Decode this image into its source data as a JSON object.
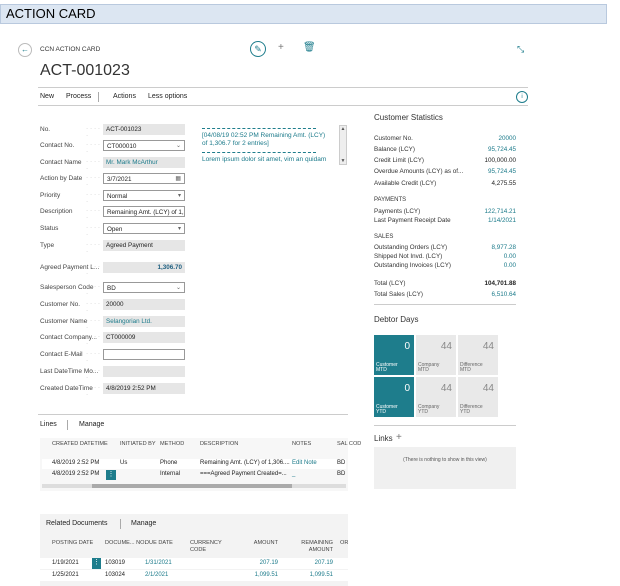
{
  "banner": {
    "title": "ACTION CARD"
  },
  "page": {
    "caption": "CCN ACTION CARD",
    "record_no": "ACT-001023",
    "icons": {
      "back": "back-arrow-icon",
      "edit": "pencil-icon",
      "new": "plus-icon",
      "delete": "trash-icon",
      "collapse": "collapse-icon",
      "info": "info-icon"
    }
  },
  "menu": {
    "new": "New",
    "process": "Process",
    "actions": "Actions",
    "less": "Less options"
  },
  "fields": [
    {
      "label": "No.",
      "value": "ACT-001023"
    },
    {
      "label": "Contact No.",
      "value": "CT000010"
    },
    {
      "label": "Contact Name",
      "value": "Mr. Mark McArthur"
    },
    {
      "label": "Action by Date",
      "value": "3/7/2021"
    },
    {
      "label": "Priority",
      "value": "Normal"
    },
    {
      "label": "Description",
      "value": "Remaining Amt. (LCY) of 1,30"
    },
    {
      "label": "Status",
      "value": "Open"
    },
    {
      "label": "Type",
      "value": "Agreed Payment"
    },
    {
      "label": "Agreed Payment L...",
      "value": "1,306.70"
    },
    {
      "label": "Salesperson Code",
      "value": "BD"
    },
    {
      "label": "Customer No.",
      "value": "20000"
    },
    {
      "label": "Customer Name",
      "value": "Selangorian Ltd."
    },
    {
      "label": "Contact Company...",
      "value": "CT000009"
    },
    {
      "label": "Contact E-Mail",
      "value": ""
    },
    {
      "label": "Last DateTime Mo...",
      "value": ""
    },
    {
      "label": "Created DateTime",
      "value": "4/8/2019 2:52 PM"
    }
  ],
  "notes": {
    "note1": "[04/08/19 02:52 PM Remaining Amt. (LCY) of 1,306.7 for 2 entries]",
    "note2": "Lorem ipsum dolor sit amet, vim an quidam"
  },
  "lines": {
    "tab": "Lines",
    "manage": "Manage",
    "headers": [
      "CREATED DATETIME",
      "INITIATED BY",
      "METHOD",
      "DESCRIPTION",
      "NOTES",
      "SAL COD"
    ],
    "rows": [
      [
        "4/8/2019 2:52 PM",
        "Us",
        "Phone",
        "Remaining Amt. (LCY) of 1,306....",
        "Edit Note",
        "BD"
      ],
      [
        "4/8/2019 2:52 PM",
        "",
        "Internal",
        "===Agreed Payment Created=...",
        "_",
        "BD"
      ]
    ]
  },
  "related": {
    "tab": "Related Documents",
    "manage": "Manage",
    "headers": [
      "POSTING DATE",
      "DOCUME... NO.",
      "DUE DATE",
      "CURRENCY CODE",
      "AMOUNT",
      "REMAINING AMOUNT",
      "OR"
    ],
    "rows": [
      [
        "1/19/2021",
        "103019",
        "1/31/2021",
        "",
        "207.19",
        "207.19"
      ],
      [
        "1/25/2021",
        "103024",
        "2/1/2021",
        "",
        "1,099.51",
        "1,099.51"
      ]
    ]
  },
  "stats": {
    "title": "Customer Statistics",
    "rows1": [
      {
        "label": "Customer No.",
        "value": "20000"
      },
      {
        "label": "Balance (LCY)",
        "value": "95,724.45"
      },
      {
        "label": "Credit Limit (LCY)",
        "value": "100,000.00"
      },
      {
        "label": "Overdue Amounts (LCY) as of...",
        "value": "95,724.45"
      },
      {
        "label": "Available Credit (LCY)",
        "value": "4,275.55"
      }
    ],
    "payments_title": "PAYMENTS",
    "payments": [
      {
        "label": "Payments (LCY)",
        "value": "122,714.21"
      },
      {
        "label": "Last Payment Receipt Date",
        "value": "1/14/2021"
      }
    ],
    "sales_title": "SALES",
    "sales": [
      {
        "label": "Outstanding Orders (LCY)",
        "value": "8,977.28"
      },
      {
        "label": "Shipped Not Invd. (LCY)",
        "value": "0.00"
      },
      {
        "label": "Outstanding Invoices (LCY)",
        "value": "0.00"
      }
    ],
    "totals": [
      {
        "label": "Total (LCY)",
        "value": "104,701.88"
      },
      {
        "label": "Total Sales (LCY)",
        "value": "6,510.64"
      }
    ]
  },
  "debtor": {
    "title": "Debtor Days",
    "tiles": [
      {
        "num": "0",
        "cap": "Customer MTD"
      },
      {
        "num": "44",
        "cap": "Company MTD"
      },
      {
        "num": "44",
        "cap": "Difference MTD"
      },
      {
        "num": "0",
        "cap": "Customer YTD"
      },
      {
        "num": "44",
        "cap": "Company YTD"
      },
      {
        "num": "44",
        "cap": "Difference YTD"
      }
    ]
  },
  "links": {
    "title": "Links",
    "plus": "+",
    "empty": "(There is nothing to show in this view)"
  }
}
